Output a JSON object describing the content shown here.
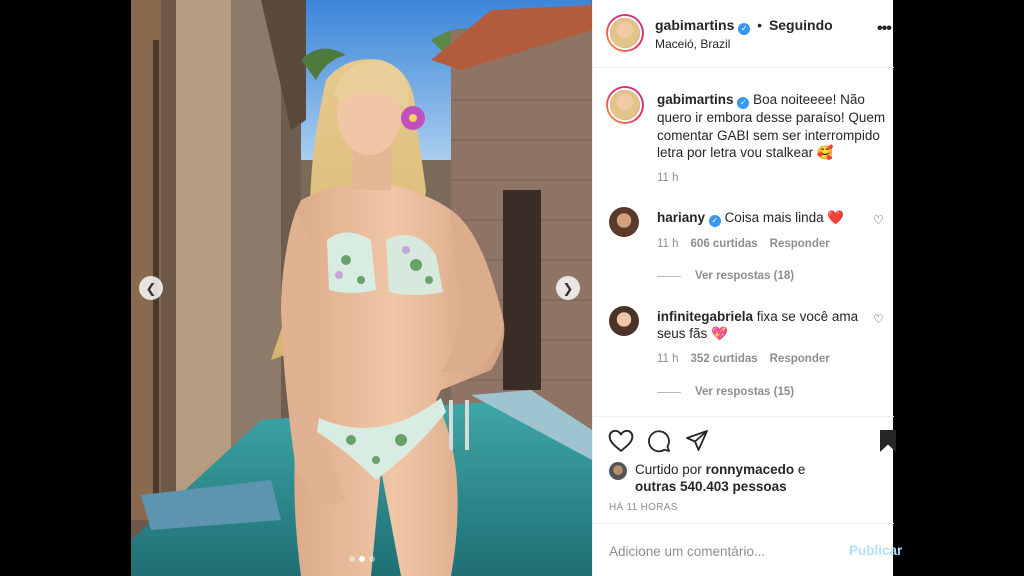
{
  "post": {
    "username": "gabimartins",
    "follow_label": "Seguindo",
    "location": "Maceió, Brazil",
    "more": "•••"
  },
  "caption": {
    "username": "gabimartins",
    "text": "Boa noiteeee! Não quero ir embora desse paraíso! Quem comentar GABI sem ser interrompido letra por letra vou stalkear 🥰",
    "time": "11 h"
  },
  "comments": [
    {
      "username": "hariany",
      "verified": true,
      "text": "Coisa mais linda ❤️",
      "time": "11 h",
      "likes": "606 curtidas",
      "reply_label": "Responder",
      "view_replies": "Ver respostas (18)"
    },
    {
      "username": "infinitegabriela",
      "verified": false,
      "text": "fixa se você ama seus fãs 💖",
      "time": "11 h",
      "likes": "352 curtidas",
      "reply_label": "Responder",
      "view_replies": "Ver respostas (15)"
    }
  ],
  "likes": {
    "prefix": "Curtido por",
    "user": "ronnymacedo",
    "conjunction": "e",
    "others": "outras 540.403 pessoas"
  },
  "timestamp": "HÁ 11 HORAS",
  "comment_box": {
    "placeholder": "Adicione um comentário...",
    "publish_label": "Publicar"
  },
  "carousel": {
    "current_index": 1,
    "total": 3
  },
  "icons": [
    "heart-icon",
    "comment-icon",
    "share-icon",
    "bookmark-icon",
    "verified-badge-icon",
    "chevron-left-icon",
    "chevron-right-icon"
  ],
  "colors": {
    "verified": "#3897f0",
    "publish": "#b2dffc",
    "muted": "#8e8e8e"
  }
}
